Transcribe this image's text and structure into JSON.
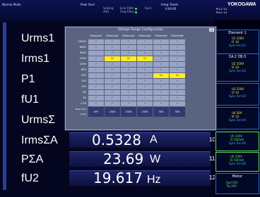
{
  "topbar": {
    "mode": "Normal Mode",
    "peak_over": "Peak Over",
    "scaling": "Scaling",
    "avg": "AVG",
    "line_filter": "Line Filter",
    "freq_filter": "Freq Filter",
    "sync": "Sync",
    "integ": "Integ: Reset",
    "integ_time": "0:00:00",
    "brand": "YOKOGAWA",
    "status_line1": "PLL1: U1",
    "status_line2": "PLL2: U1",
    "led_color": "#3cff3c"
  },
  "measure": {
    "rows": [
      {
        "label": "Urms1",
        "value": "",
        "unit": "",
        "index": ""
      },
      {
        "label": "Irms1",
        "value": "",
        "unit": "",
        "index": ""
      },
      {
        "label": "P1",
        "value": "",
        "unit": "",
        "index": ""
      },
      {
        "label": "fU1",
        "value": "",
        "unit": "",
        "index": ""
      },
      {
        "label": "UrmsΣ",
        "value": "",
        "unit": "",
        "index": ""
      },
      {
        "label": "IrmsΣA",
        "value": "0.5328",
        "unit": "A",
        "index": "10"
      },
      {
        "label": "PΣA",
        "value": "23.69",
        "unit": "W",
        "index": "11"
      },
      {
        "label": "fU2",
        "value": "19.617",
        "unit": "Hz",
        "index": "12"
      }
    ]
  },
  "dialog": {
    "title": "Voltage Range Configuration",
    "close": "×",
    "columns": [
      "",
      "Element1",
      "Element2",
      "Element3",
      "Element4",
      "Element5",
      "Element6"
    ],
    "rows": [
      {
        "range": "1000V",
        "cells": [
          "on",
          "on",
          "on",
          "on",
          "on",
          "on"
        ]
      },
      {
        "range": "600V",
        "cells": [
          "on",
          "on",
          "on",
          "on",
          "on",
          "on"
        ]
      },
      {
        "range": "300V",
        "cells": [
          "on",
          "on",
          "on",
          "on",
          "on",
          "on"
        ]
      },
      {
        "range": "150V",
        "cells": [
          "on",
          "sel",
          "sel",
          "sel",
          "on",
          "on"
        ]
      },
      {
        "range": "100V",
        "cells": [
          "on",
          "on",
          "on",
          "on",
          "on",
          "on"
        ]
      },
      {
        "range": "60V",
        "cells": [
          "on",
          "on",
          "on",
          "on",
          "on",
          "on"
        ]
      },
      {
        "range": "30V",
        "cells": [
          "on",
          "on",
          "on",
          "on",
          "sel",
          "sel"
        ]
      },
      {
        "range": "15V",
        "cells": [
          "on",
          "on",
          "on",
          "on",
          "on",
          "on"
        ]
      },
      {
        "range": "10V",
        "cells": [
          "on",
          "on",
          "on",
          "on",
          "on",
          "on"
        ]
      },
      {
        "range": "6V",
        "cells": [
          "on",
          "on",
          "on",
          "on",
          "on",
          "on"
        ]
      },
      {
        "range": "3V",
        "cells": [
          "on",
          "on",
          "on",
          "on",
          "on",
          "on"
        ]
      },
      {
        "range": "1.5V",
        "cells": [
          "on",
          "on",
          "on",
          "on",
          "on",
          "on"
        ]
      }
    ],
    "footer_label": "Peak Over Jump",
    "footer_cells": [
      "OFF",
      "150V",
      "150V",
      "150V",
      "30V",
      "30V"
    ]
  },
  "right_panel": {
    "element1_header": "Element 1",
    "element1_lines": [
      "U1  150V",
      "I1  1A",
      "Sync Src:U1"
    ],
    "element2_header": "ΣA:2  ΣB:3",
    "element2_lines": [
      "U2  150V",
      "I2  1A",
      "Sync Src:U2"
    ],
    "element3_lines": [
      "U3  150V",
      "I3  1A",
      "Sync Src:U3"
    ],
    "element4_lines": [
      "U4  30V",
      "I4  1A",
      "Sync Src:U4"
    ],
    "element5_lines": [
      "U5  100V",
      "I5  500mA",
      "Sync Src:U5"
    ],
    "element6_lines": [
      "U6  100V",
      "I6  500mA",
      "Sync Src:U6"
    ],
    "motor_header": "Motor",
    "motor_lines": [
      "Spd  20V",
      "Trq  20V"
    ]
  }
}
